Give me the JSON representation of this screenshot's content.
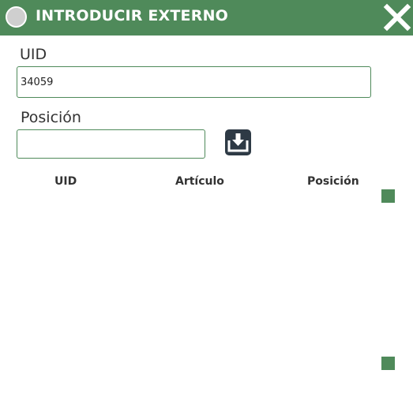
{
  "window": {
    "title": "INTRODUCIR EXTERNO",
    "accent_color": "#4f8a5a",
    "status_icon": "circle-icon",
    "close_icon": "close-icon"
  },
  "form": {
    "uid_label": "UID",
    "uid_value": "34059",
    "position_label": "Posición",
    "position_value": "",
    "load_icon": "download-tray-icon"
  },
  "table": {
    "columns": [
      "UID",
      "Artículo",
      "Posición"
    ],
    "rows": []
  },
  "scroll": {
    "up_icon": "scroll-up-square-icon",
    "down_icon": "scroll-down-square-icon"
  }
}
